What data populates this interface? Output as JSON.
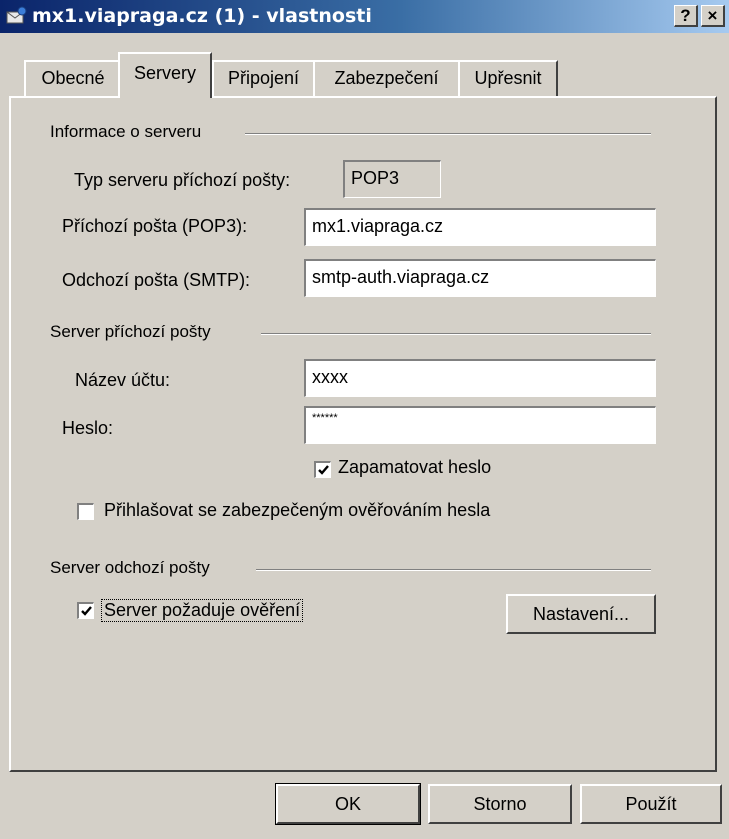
{
  "window": {
    "title": "mx1.viapraga.cz (1) - vlastnosti",
    "help_button": "?",
    "close_button": "×"
  },
  "tabs": [
    {
      "label": "Obecné",
      "active": false
    },
    {
      "label": "Servery",
      "active": true
    },
    {
      "label": "Připojení",
      "active": false
    },
    {
      "label": "Zabezpečení",
      "active": false
    },
    {
      "label": "Upřesnit",
      "active": false
    }
  ],
  "server_info": {
    "group_label": "Informace o serveru",
    "incoming_type_label": "Typ serveru příchozí pošty:",
    "incoming_type_value": "POP3",
    "incoming_label": "Příchozí pošta (POP3):",
    "incoming_value": "mx1.viapraga.cz",
    "outgoing_label": "Odchozí pošta (SMTP):",
    "outgoing_value": "smtp-auth.viapraga.cz"
  },
  "incoming_server": {
    "group_label": "Server příchozí pošty",
    "account_label": "Název účtu:",
    "account_value": "xxxx",
    "password_label": "Heslo:",
    "password_value": "******",
    "remember_label": "Zapamatovat heslo",
    "remember_checked": true,
    "spa_label": "Přihlašovat se zabezpečeným ověřováním hesla",
    "spa_checked": false
  },
  "outgoing_server": {
    "group_label": "Server odchozí pošty",
    "auth_label": "Server požaduje ověření",
    "auth_checked": true,
    "settings_button": "Nastavení..."
  },
  "buttons": {
    "ok": "OK",
    "cancel": "Storno",
    "apply": "Použít"
  }
}
